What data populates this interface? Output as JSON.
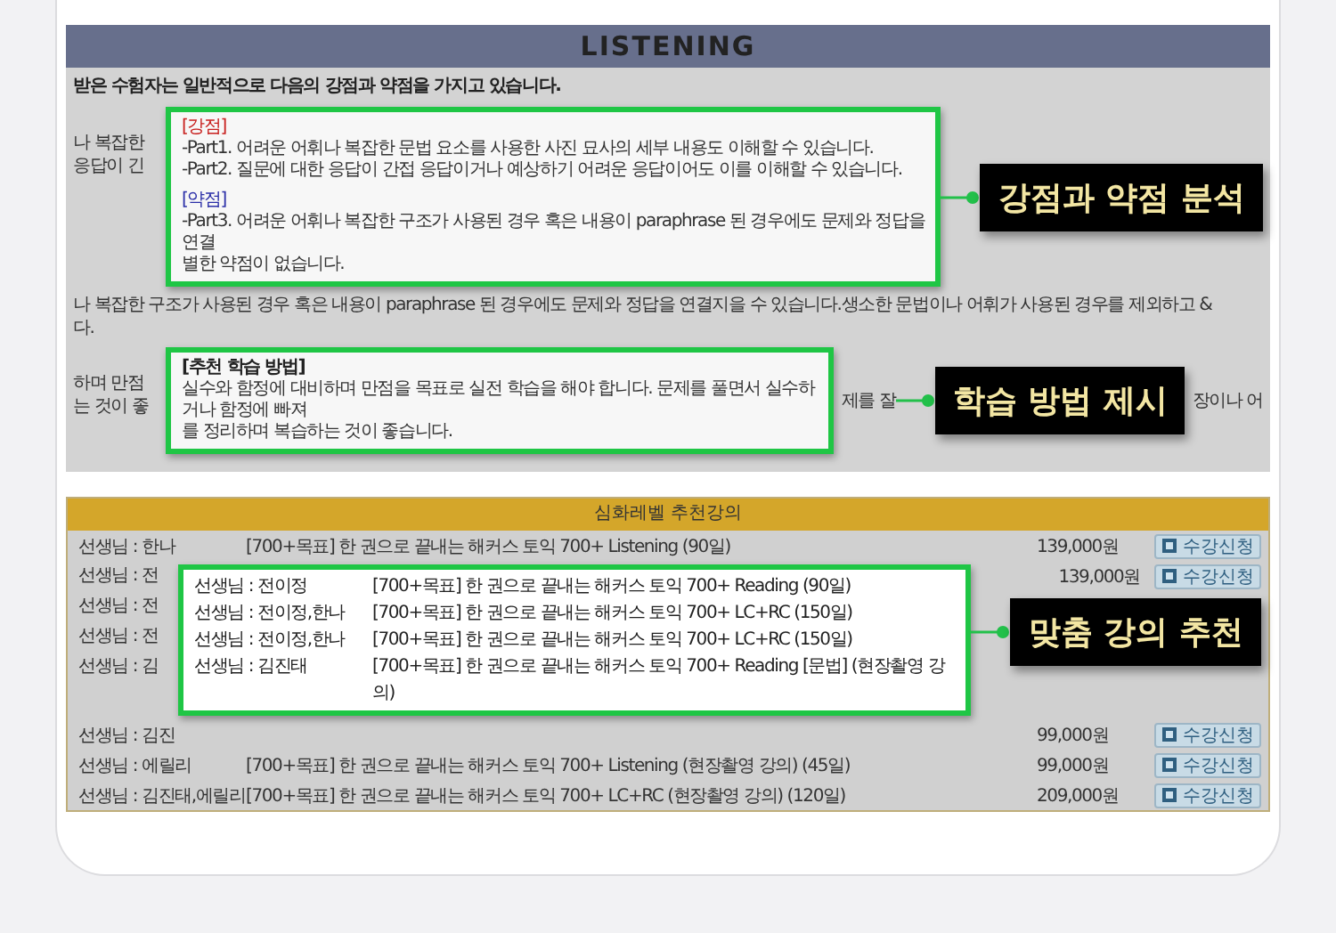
{
  "report": {
    "title": "LISTENING",
    "intro": "받은 수험자는 일반적으로 다음의 강점과 약점을 가지고 있습니다.",
    "covered_lines": [
      "나 복잡한",
      "응답이 긴"
    ],
    "full_line": "나 복잡한 구조가 사용된 경우 혹은 내용이 paraphrase 된 경우에도 문제와 정답을 연결지을 수 있습니다.생소한 문법이나 어휘가 사용된 경우를 제외하고 &",
    "full_line_end": "다.",
    "covered_lines_2": [
      "하며 만점",
      "는 것이 좋"
    ],
    "middle_fragment": "제를 잘",
    "edge_fragment": "장이나 어"
  },
  "analysis_callout": {
    "sections": [
      {
        "kind": "strength",
        "heading": "[강점]",
        "lines": [
          "-Part1. 어려운 어휘나 복잡한 문법 요소를 사용한 사진 묘사의 세부 내용도 이해할 수 있습니다.",
          "-Part2. 질문에 대한 응답이 간접 응답이거나 예상하기 어려운 응답이어도 이를 이해할 수 있습니다."
        ]
      },
      {
        "kind": "weakness",
        "heading": "[약점]",
        "lines": [
          "-Part3. 어려운 어휘나 복잡한 구조가 사용된 경우 혹은 내용이 paraphrase 된 경우에도 문제와 정답을 연결",
          "별한 약점이 없습니다."
        ]
      }
    ],
    "label": "강점과 약점 분석"
  },
  "method_callout": {
    "heading": "[추천 학습 방법]",
    "lines": [
      "실수와 함정에 대비하며 만점을 목표로 실전 학습을 해야 합니다. 문제를 풀면서 실수하거나 함정에 빠져",
      "를 정리하며 복습하는 것이 좋습니다."
    ],
    "label": "학습 방법 제시"
  },
  "courses": {
    "title": "심화레벨 추천강의",
    "rows": [
      {
        "teacher": "선생님 : 한나",
        "course": "[700+목표] 한 권으로 끝내는 해커스 토익 700+ Listening (90일)",
        "price": "139,000원",
        "button": "수강신청"
      },
      {
        "teacher": "선생님 : 전",
        "price": "139,000원",
        "button": "수강신청"
      },
      {
        "teacher": "선생님 : 전"
      },
      {
        "teacher": "선생님 : 전"
      },
      {
        "teacher": "선생님 : 김"
      },
      {
        "teacher": "선생님 : 김진",
        "price": "99,000원",
        "button": "수강신청"
      },
      {
        "teacher": "선생님 : 에릴리",
        "course": "[700+목표] 한 권으로 끝내는 해커스 토익 700+ Listening (현장촬영 강의) (45일)",
        "price": "99,000원",
        "button": "수강신청"
      },
      {
        "teacher": "선생님 : 김진태,에릴리",
        "course": "[700+목표] 한 권으로 끝내는 해커스 토익 700+ LC+RC (현장촬영 강의) (120일)",
        "price": "209,000원",
        "button": "수강신청"
      }
    ]
  },
  "course_callout": {
    "rows": [
      {
        "teacher": "선생님 : 전이정",
        "course": "[700+목표] 한 권으로 끝내는 해커스 토익 700+ Reading (90일)"
      },
      {
        "teacher": "선생님 : 전이정,한나",
        "course": "[700+목표] 한 권으로 끝내는 해커스 토익 700+ LC+RC (150일)"
      },
      {
        "teacher": "선생님 : 전이정,한나",
        "course": "[700+목표] 한 권으로 끝내는 해커스 토익 700+ LC+RC (150일)"
      },
      {
        "teacher": "선생님 : 김진태",
        "course": "[700+목표] 한 권으로 끝내는 해커스 토익 700+ Reading [문법] (현장촬영 강의)"
      }
    ],
    "label": "맞춤 강의 추천"
  }
}
